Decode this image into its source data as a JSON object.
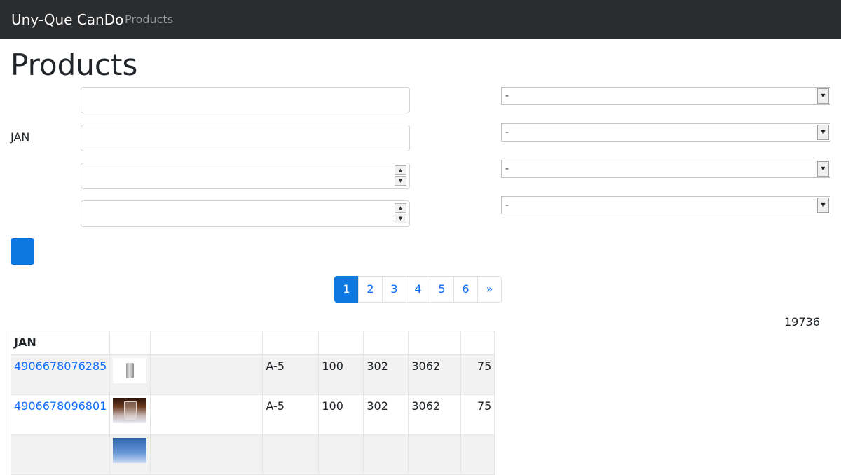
{
  "navbar": {
    "brand": "Uny-Que CanDo",
    "link": "Products"
  },
  "page": {
    "title": "Products"
  },
  "filters": {
    "labels": [
      "",
      "JAN",
      "",
      ""
    ],
    "inputs": [
      {
        "value": "",
        "placeholder": ""
      },
      {
        "value": "",
        "placeholder": ""
      },
      {
        "value": "",
        "placeholder": "",
        "type": "number"
      },
      {
        "value": "",
        "placeholder": "",
        "type": "number"
      }
    ],
    "selects": [
      {
        "selected": "-"
      },
      {
        "selected": "-"
      },
      {
        "selected": "-"
      },
      {
        "selected": "-"
      }
    ],
    "submit_label": "",
    "submit_color": "#0d78e0"
  },
  "pagination": {
    "pages": [
      "1",
      "2",
      "3",
      "4",
      "5",
      "6",
      "»"
    ],
    "active_page": "1"
  },
  "total_count": "19736",
  "table": {
    "headers": [
      "JAN",
      "",
      "",
      "",
      "",
      "",
      "",
      ""
    ],
    "rows": [
      {
        "jan": "4906678076285",
        "image": "product-glass-icon",
        "name": "",
        "grade": "A-5",
        "c4": "100",
        "c5": "302",
        "c6": "3062",
        "c7": "75"
      },
      {
        "jan": "4906678096801",
        "image": "product-glass-icon",
        "name": "",
        "grade": "A-5",
        "c4": "100",
        "c5": "302",
        "c6": "3062",
        "c7": "75"
      },
      {
        "jan": "",
        "image": "product-image-icon",
        "name": "",
        "grade": "",
        "c4": "",
        "c5": "",
        "c6": "",
        "c7": ""
      }
    ]
  },
  "colors": {
    "navbar_bg": "#2b2c2e",
    "accent": "#0d78e0",
    "link": "#0d6efd"
  }
}
